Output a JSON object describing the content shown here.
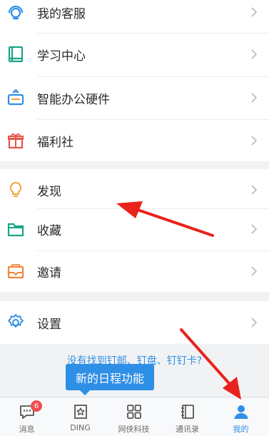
{
  "menu": {
    "group1": [
      {
        "label": "我的客服",
        "icon": "customer-service-icon"
      },
      {
        "label": "学习中心",
        "icon": "book-icon"
      },
      {
        "label": "智能办公硬件",
        "icon": "smart-hardware-icon"
      },
      {
        "label": "福利社",
        "icon": "gift-icon"
      }
    ],
    "group2": [
      {
        "label": "发现",
        "icon": "lightbulb-icon"
      },
      {
        "label": "收藏",
        "icon": "folder-icon"
      },
      {
        "label": "邀请",
        "icon": "invite-envelope-icon"
      }
    ],
    "group3": [
      {
        "label": "设置",
        "icon": "gear-icon"
      }
    ]
  },
  "hint_link": "没有找到钉邮、钉盘、钉钉卡?",
  "tooltip": "新的日程功能",
  "tabbar": {
    "tabs": [
      {
        "label": "消息",
        "icon": "message-icon",
        "badge": "6"
      },
      {
        "label": "DING",
        "icon": "ding-icon"
      },
      {
        "label": "网侠科技",
        "icon": "grid-icon"
      },
      {
        "label": "通讯录",
        "icon": "contacts-icon"
      },
      {
        "label": "我的",
        "icon": "profile-icon",
        "active": true
      }
    ]
  },
  "colors": {
    "accent": "#2e8fe6",
    "badge": "#f04e4e",
    "annotation_arrow": "#e8221c"
  }
}
